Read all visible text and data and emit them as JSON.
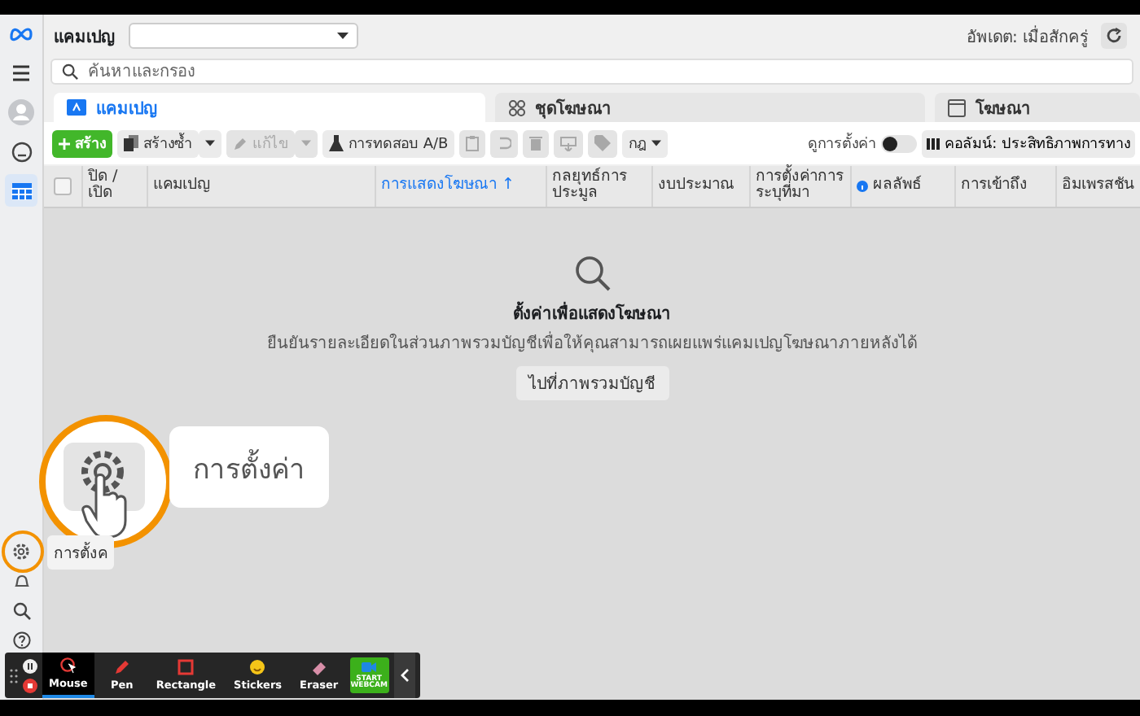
{
  "sidebar": {
    "items": [
      {
        "kind": "logo",
        "selected": false
      },
      {
        "kind": "menu",
        "selected": false
      },
      {
        "kind": "avatar",
        "selected": false
      },
      {
        "kind": "face",
        "selected": false
      },
      {
        "kind": "table",
        "selected": true
      }
    ],
    "bottom_items": [
      {
        "kind": "gear",
        "selected": false
      },
      {
        "kind": "bell",
        "selected": false
      },
      {
        "kind": "search",
        "selected": false
      },
      {
        "kind": "help",
        "selected": false
      }
    ]
  },
  "header": {
    "title": "แคมเปญ",
    "updated": "อัพเดต: เมื่อสักครู่"
  },
  "search": {
    "placeholder": "ค้นหาและกรอง"
  },
  "tabs": [
    {
      "label": "แคมเปญ",
      "selected": true,
      "kind": "folder"
    },
    {
      "label": "ชุดโฆษณา",
      "selected": false,
      "kind": "grid"
    },
    {
      "label": "โฆษณา",
      "selected": false,
      "kind": "page"
    }
  ],
  "toolbar": {
    "buttons": [
      {
        "kind": "create",
        "label": "สร้าง",
        "disabled": false
      },
      {
        "kind": "duplicate",
        "label": "สร้างซ้ำ",
        "disabled": false
      },
      {
        "kind": "edit",
        "label": "แก้ไข",
        "disabled": true
      },
      {
        "kind": "abtest",
        "label": "การทดสอบ A/B",
        "disabled": false
      },
      {
        "kind": "clipboard",
        "disabled": true
      },
      {
        "kind": "undo",
        "disabled": true
      },
      {
        "kind": "trash",
        "disabled": true
      },
      {
        "kind": "export",
        "disabled": true
      },
      {
        "kind": "tag",
        "disabled": true
      },
      {
        "kind": "rules",
        "label": "กฎ",
        "disabled": false
      }
    ],
    "toggle": {
      "label": "ดูการตั้งค่า",
      "on": false
    },
    "columns_button": "คอลัมน์: ประสิทธิภาพการทาง"
  },
  "table": {
    "select_all": {
      "checked": false
    },
    "columns": [
      {
        "label": "ปิด / เปิด",
        "sorted": false
      },
      {
        "label": "แคมเปญ",
        "sorted": false
      },
      {
        "label": "การแสดงโฆษณา ↑",
        "sorted": true
      },
      {
        "label": "กลยุทธ์การประมูล",
        "sorted": false
      },
      {
        "label": "งบประมาณ",
        "sorted": false
      },
      {
        "label": "การตั้งค่าการระบุที่มา",
        "sorted": false
      },
      {
        "label": "ผลลัพธ์",
        "sorted": false
      },
      {
        "label": "การเข้าถึง",
        "sorted": false
      },
      {
        "label": "อิมเพรสชัน",
        "sorted": false
      }
    ]
  },
  "empty_state": {
    "title": "ตั้งค่าเพื่อแสดงโฆษณา",
    "message": "ยืนยันรายละเอียดในส่วนภาพรวมบัญชีเพื่อให้คุณสามารถเผยแพร่แคมเปญโฆษณาภายหลังได้",
    "button": "ไปที่ภาพรวมบัญชี"
  },
  "callout": {
    "label": "การตั้งค่า"
  },
  "tooltip": {
    "label": "การตั้งค"
  },
  "recorder": {
    "tools": [
      {
        "kind": "mouse",
        "label": "Mouse",
        "selected": true
      },
      {
        "kind": "pen",
        "label": "Pen",
        "selected": false
      },
      {
        "kind": "rectangle",
        "label": "Rectangle",
        "selected": false
      },
      {
        "kind": "stickers",
        "label": "Stickers",
        "selected": false
      },
      {
        "kind": "eraser",
        "label": "Eraser",
        "selected": false
      },
      {
        "kind": "webcam",
        "label": "START WEBCAM",
        "selected": false
      }
    ]
  }
}
